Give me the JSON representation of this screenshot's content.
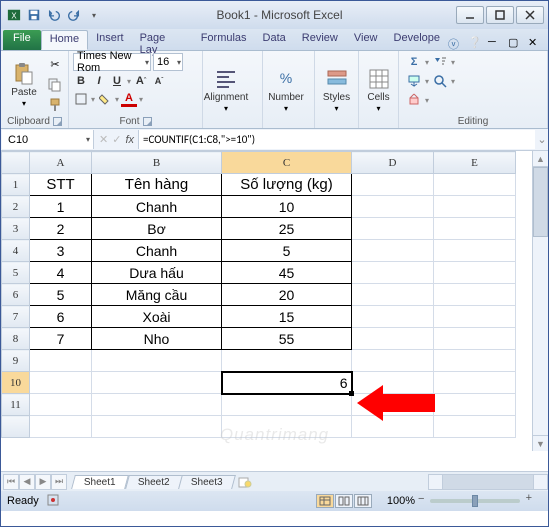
{
  "titlebar": {
    "title": "Book1 - Microsoft Excel"
  },
  "tabs": {
    "file": "File",
    "items": [
      "Home",
      "Insert",
      "Page Lay",
      "Formulas",
      "Data",
      "Review",
      "View",
      "Develope"
    ]
  },
  "ribbon": {
    "clipboard": {
      "paste": "Paste",
      "label": "Clipboard"
    },
    "font": {
      "name": "Times New Rom",
      "size": "16",
      "label": "Font"
    },
    "alignment": {
      "label": "Alignment"
    },
    "number": {
      "label": "Number"
    },
    "styles": {
      "label": "Styles"
    },
    "cells": {
      "label": "Cells"
    },
    "editing": {
      "label": "Editing"
    }
  },
  "namebox": "C10",
  "formula": "=COUNTIF(C1:C8,\">=10\")",
  "columns": [
    "A",
    "B",
    "C",
    "D",
    "E"
  ],
  "rows": [
    "1",
    "2",
    "3",
    "4",
    "5",
    "6",
    "7",
    "8",
    "9",
    "10",
    "11"
  ],
  "table": {
    "headers": [
      "STT",
      "Tên hàng",
      "Số lượng (kg)"
    ],
    "data": [
      [
        "1",
        "Chanh",
        "10"
      ],
      [
        "2",
        "Bơ",
        "25"
      ],
      [
        "3",
        "Chanh",
        "5"
      ],
      [
        "4",
        "Dưa hấu",
        "45"
      ],
      [
        "5",
        "Măng cầu",
        "20"
      ],
      [
        "6",
        "Xoài",
        "15"
      ],
      [
        "7",
        "Nho",
        "55"
      ]
    ]
  },
  "result": "6",
  "sheets": [
    "Sheet1",
    "Sheet2",
    "Sheet3"
  ],
  "status": {
    "ready": "Ready",
    "zoom": "100%"
  },
  "watermark": "Quantrimang"
}
